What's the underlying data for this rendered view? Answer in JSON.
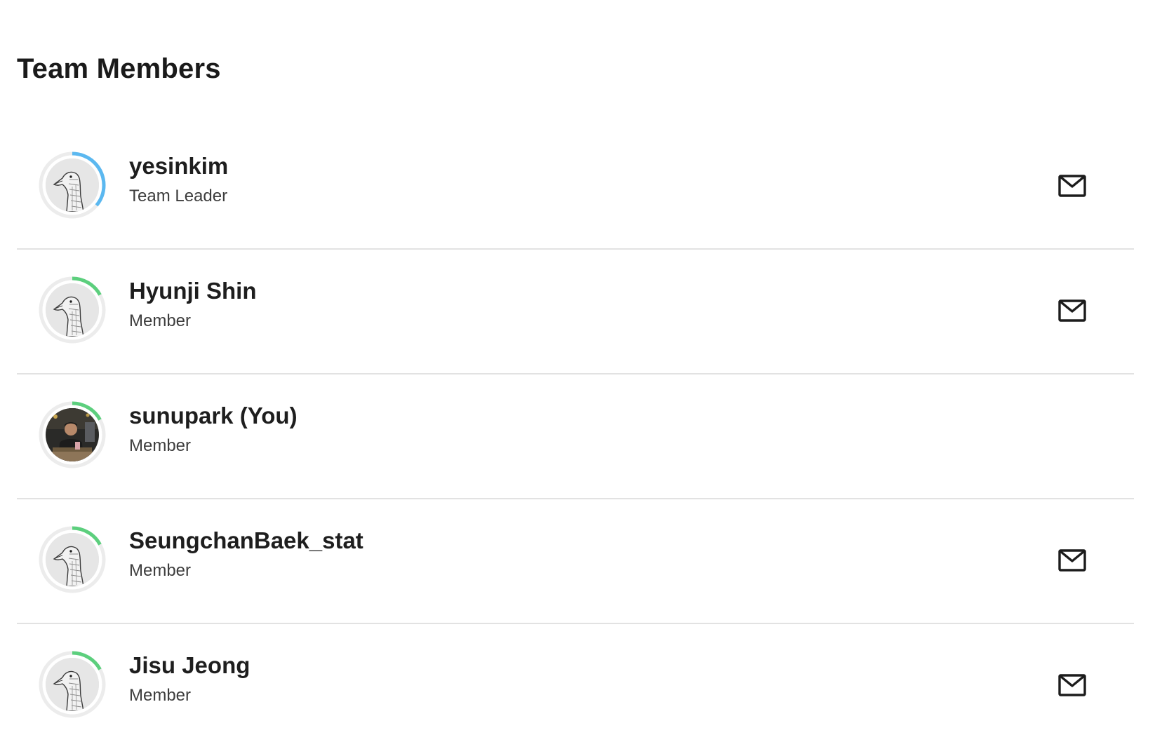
{
  "page": {
    "title": "Team Members"
  },
  "colors": {
    "ring_leader": "#5bb8f0",
    "ring_member": "#5ccf7d",
    "ring_track": "#ececec",
    "divider": "#e2e2e2"
  },
  "members": [
    {
      "name": "yesinkim",
      "role": "Team Leader",
      "avatar": "goose-avatar",
      "ring_fraction": 0.36,
      "ring_color": "#5bb8f0",
      "mail_icon": "mail-icon",
      "has_mail": true
    },
    {
      "name": "Hyunji Shin",
      "role": "Member",
      "avatar": "goose-avatar",
      "ring_fraction": 0.17,
      "ring_color": "#5ccf7d",
      "mail_icon": "mail-icon",
      "has_mail": true
    },
    {
      "name": "sunupark (You)",
      "role": "Member",
      "avatar": "photo-avatar",
      "ring_fraction": 0.17,
      "ring_color": "#5ccf7d",
      "has_mail": false
    },
    {
      "name": "SeungchanBaek_stat",
      "role": "Member",
      "avatar": "goose-avatar",
      "ring_fraction": 0.17,
      "ring_color": "#5ccf7d",
      "mail_icon": "mail-icon",
      "has_mail": true
    },
    {
      "name": "Jisu Jeong",
      "role": "Member",
      "avatar": "goose-avatar",
      "ring_fraction": 0.17,
      "ring_color": "#5ccf7d",
      "mail_icon": "mail-icon",
      "has_mail": true
    }
  ]
}
